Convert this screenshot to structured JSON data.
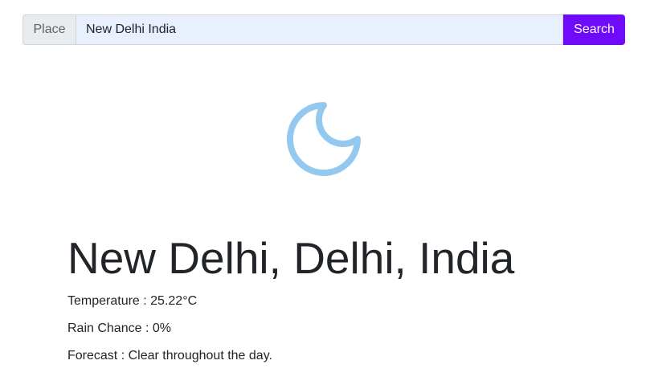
{
  "search": {
    "addon_label": "Place",
    "value": "New Delhi India",
    "button_label": "Search"
  },
  "weather": {
    "icon": "clear-night-moon-icon",
    "icon_color": "#94c9ef",
    "location": "New Delhi, Delhi, India",
    "temperature_label": "Temperature : ",
    "temperature_value": "25.22°C",
    "rain_label": "Rain Chance : ",
    "rain_value": "0%",
    "forecast_label": "Forecast : ",
    "forecast_value": "Clear throughout the day."
  },
  "colors": {
    "accent": "#6f0afa",
    "input_background": "#e8f0fe",
    "text": "#212529"
  }
}
